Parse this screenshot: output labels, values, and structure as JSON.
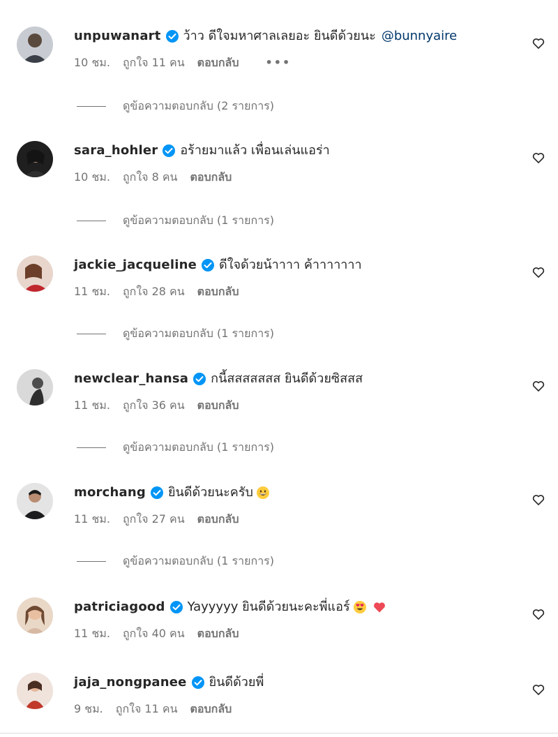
{
  "comments": [
    {
      "username": "unpuwanart",
      "text": "ว้าว ดีใจมหาศาลเลยอะ ยินดีด้วยนะ",
      "mention": "@bunnyaire",
      "time": "10 ชม.",
      "likes": "ถูกใจ 11 คน",
      "reply_label": "ตอบกลับ",
      "more": "•••",
      "view_replies": "ดูข้อความตอบกลับ (2 รายการ)",
      "avatar_color": "#5a5f66"
    },
    {
      "username": "sara_hohler",
      "text": "อร้ายมาแล้ว เพื่อนเล่นแอร่า",
      "time": "10 ชม.",
      "likes": "ถูกใจ 8 คน",
      "reply_label": "ตอบกลับ",
      "view_replies": "ดูข้อความตอบกลับ (1 รายการ)",
      "avatar_color": "#2b2a2a"
    },
    {
      "username": "jackie_jacqueline",
      "text": "ดีใจด้วยน้าาาา ค้าาาาาาา",
      "time": "11 ชม.",
      "likes": "ถูกใจ 28 คน",
      "reply_label": "ตอบกลับ",
      "view_replies": "ดูข้อความตอบกลับ (1 รายการ)",
      "avatar_color": "#c9a08e"
    },
    {
      "username": "newclear_hansa",
      "text": "กนี้สสสสสสส ยินดีด้วยซิสสส",
      "time": "11 ชม.",
      "likes": "ถูกใจ 36 คน",
      "reply_label": "ตอบกลับ",
      "view_replies": "ดูข้อความตอบกลับ (1 รายการ)",
      "avatar_color": "#8a8a8a"
    },
    {
      "username": "morchang",
      "text": "ยินดีด้วยนะครับ",
      "emoji": "grinning-face",
      "time": "11 ชม.",
      "likes": "ถูกใจ 27 คน",
      "reply_label": "ตอบกลับ",
      "view_replies": "ดูข้อความตอบกลับ (1 รายการ)",
      "avatar_color": "#3a3a3c"
    },
    {
      "username": "patriciagood",
      "text": "Yayyyyy ยินดีด้วยนะคะพี่แอร์",
      "emoji": "heart-eyes-face",
      "emoji2": "red-heart",
      "time": "11 ชม.",
      "likes": "ถูกใจ 40 คน",
      "reply_label": "ตอบกลับ",
      "avatar_color": "#b58a6c"
    },
    {
      "username": "jaja_nongpanee",
      "text": "ยินดีด้วยพี่",
      "time": "9 ชม.",
      "likes": "ถูกใจ 11 คน",
      "reply_label": "ตอบกลับ",
      "avatar_color": "#c0392b"
    }
  ],
  "colors": {
    "verified": "#0095f6",
    "mention": "#00376b",
    "secondary_text": "#737373",
    "heart_red": "#ed4956"
  },
  "icons": {
    "verified": "verified-badge-icon",
    "like": "heart-outline-icon"
  }
}
